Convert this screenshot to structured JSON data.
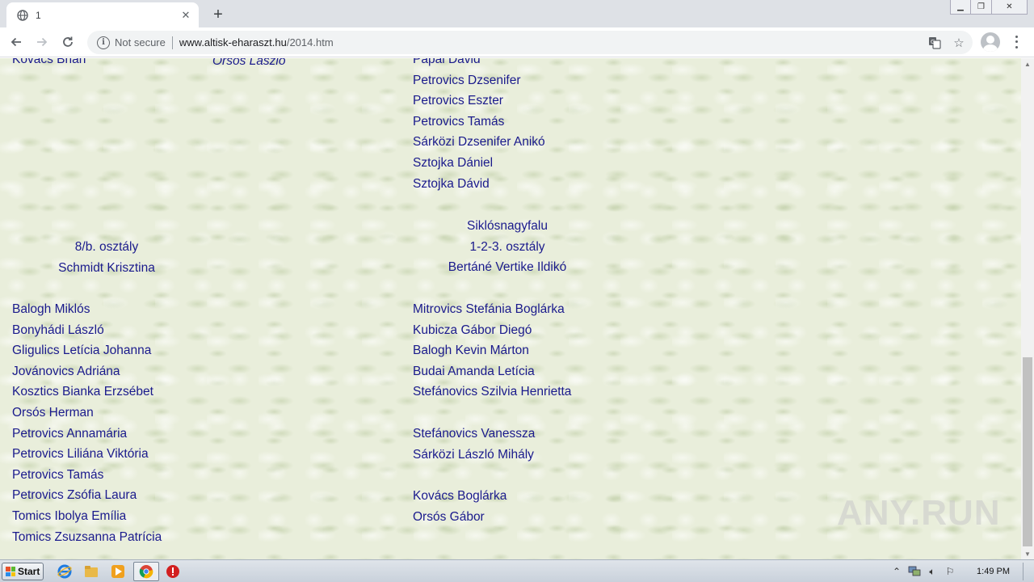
{
  "browser": {
    "tab_title": "1",
    "tab_close": "✕",
    "new_tab": "+",
    "not_secure": "Not secure",
    "url_host": "www.altisk-eharaszt.hu",
    "url_path": "/2014.htm"
  },
  "page": {
    "col1_top": [
      "Kovács Brian"
    ],
    "col2_top": [
      "Orsós László"
    ],
    "col3_top": [
      "Pápai Dávid",
      "Petrovics Dzsenifer",
      "Petrovics Eszter",
      "Petrovics Tamás",
      "Sárközi Dzsenifer  Anikó",
      "Sztojka Dániel",
      "Sztojka Dávid"
    ],
    "section_left": {
      "heading": "8/b. osztály",
      "teacher": "Schmidt Krisztina"
    },
    "section_right": {
      "location": "Siklósnagyfalu",
      "heading": "1-2-3. osztály",
      "teacher": "Bertáné Vertike Ildikó"
    },
    "left_students": [
      "Balogh Miklós",
      "Bonyhádi László",
      "Gligulics Letícia Johanna",
      "Jovánovics Adriána",
      "Kosztics Bianka Erzsébet",
      "Orsós Herman",
      "Petrovics Annamária",
      "Petrovics Liliána Viktória",
      "Petrovics Tamás",
      "Petrovics Zsófia Laura",
      "Tomics Ibolya  Emília",
      "Tomics Zsuzsanna Patrícia"
    ],
    "right_students_a": [
      "Mitrovics Stefánia Boglárka",
      "Kubicza Gábor Diegó",
      "Balogh Kevin Márton",
      "Budai Amanda Letícia",
      "Stefánovics Szilvia Henrietta"
    ],
    "right_students_b": [
      "Stefánovics Vanessza",
      "Sárközi László Mihály"
    ],
    "right_students_c": [
      "Kovács Boglárka",
      "Orsós Gábor"
    ]
  },
  "watermark": "ANY.RUN",
  "taskbar": {
    "start_label": "Start",
    "clock": "1:49 PM"
  }
}
